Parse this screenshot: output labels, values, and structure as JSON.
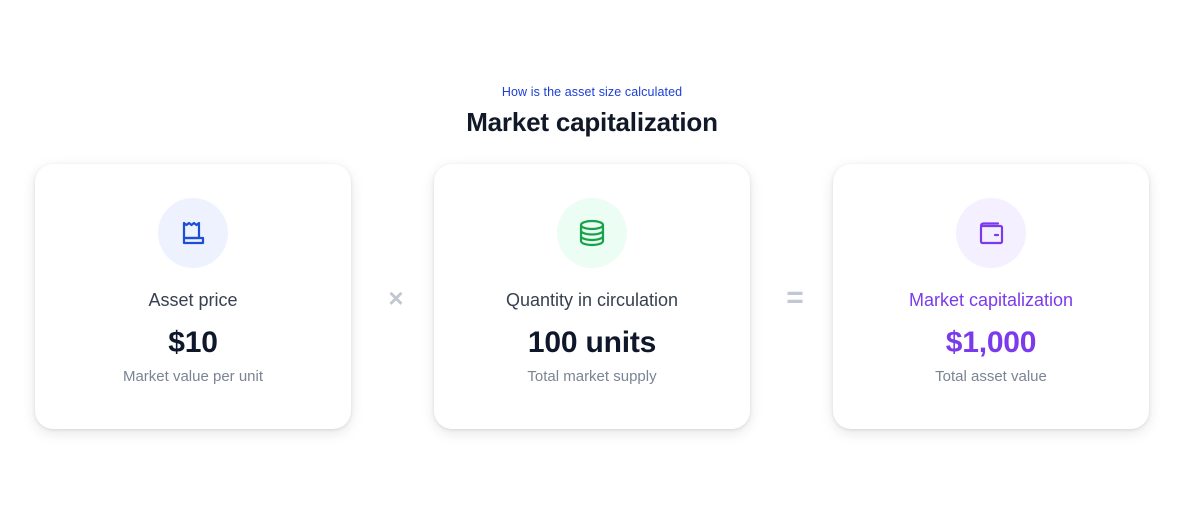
{
  "header": {
    "eyebrow": "How is the asset size calculated",
    "title": "Market capitalization"
  },
  "cards": [
    {
      "icon": "receipt-icon",
      "label": "Asset price",
      "value": "$10",
      "subtext": "Market value per unit"
    },
    {
      "icon": "database-icon",
      "label": "Quantity in circulation",
      "value": "100 units",
      "subtext": "Total market supply"
    },
    {
      "icon": "wallet-icon",
      "label": "Market capitalization",
      "value": "$1,000",
      "subtext": "Total asset value"
    }
  ],
  "operators": {
    "multiply": "×",
    "equals": "="
  },
  "colors": {
    "eyebrow": "#1d3fd6",
    "card1_icon": "#1d4ed8",
    "card1_icon_bg": "#eef2ff",
    "card2_icon": "#16a34a",
    "card2_icon_bg": "#ecfdf3",
    "card3_icon": "#7c3aed",
    "card3_icon_bg": "#f5f0ff",
    "card3_text": "#7c3aed",
    "operator": "#c2c8d2"
  }
}
